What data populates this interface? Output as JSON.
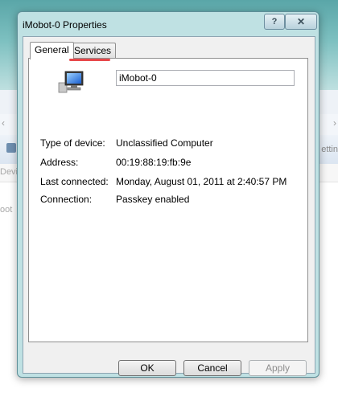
{
  "background": {
    "frag_left": "Devi",
    "frag_left2": "oot",
    "frag_right": "ettin"
  },
  "dialog": {
    "title": "iMobot-0 Properties",
    "help": "?",
    "close": "✕",
    "tabs": [
      {
        "label": "General",
        "active": true
      },
      {
        "label": "Services",
        "active": false
      }
    ],
    "general": {
      "device_name": "iMobot-0",
      "properties": [
        {
          "label": "Type of device:",
          "value": "Unclassified Computer"
        },
        {
          "label": "Address:",
          "value": "00:19:88:19:fb:9e"
        },
        {
          "label": "Last connected:",
          "value": "Monday, August 01, 2011 at 2:40:57 PM"
        },
        {
          "label": "Connection:",
          "value": "Passkey enabled"
        }
      ]
    },
    "buttons": {
      "ok": "OK",
      "cancel": "Cancel",
      "apply": "Apply"
    }
  },
  "annotation_color": "#e8484b"
}
